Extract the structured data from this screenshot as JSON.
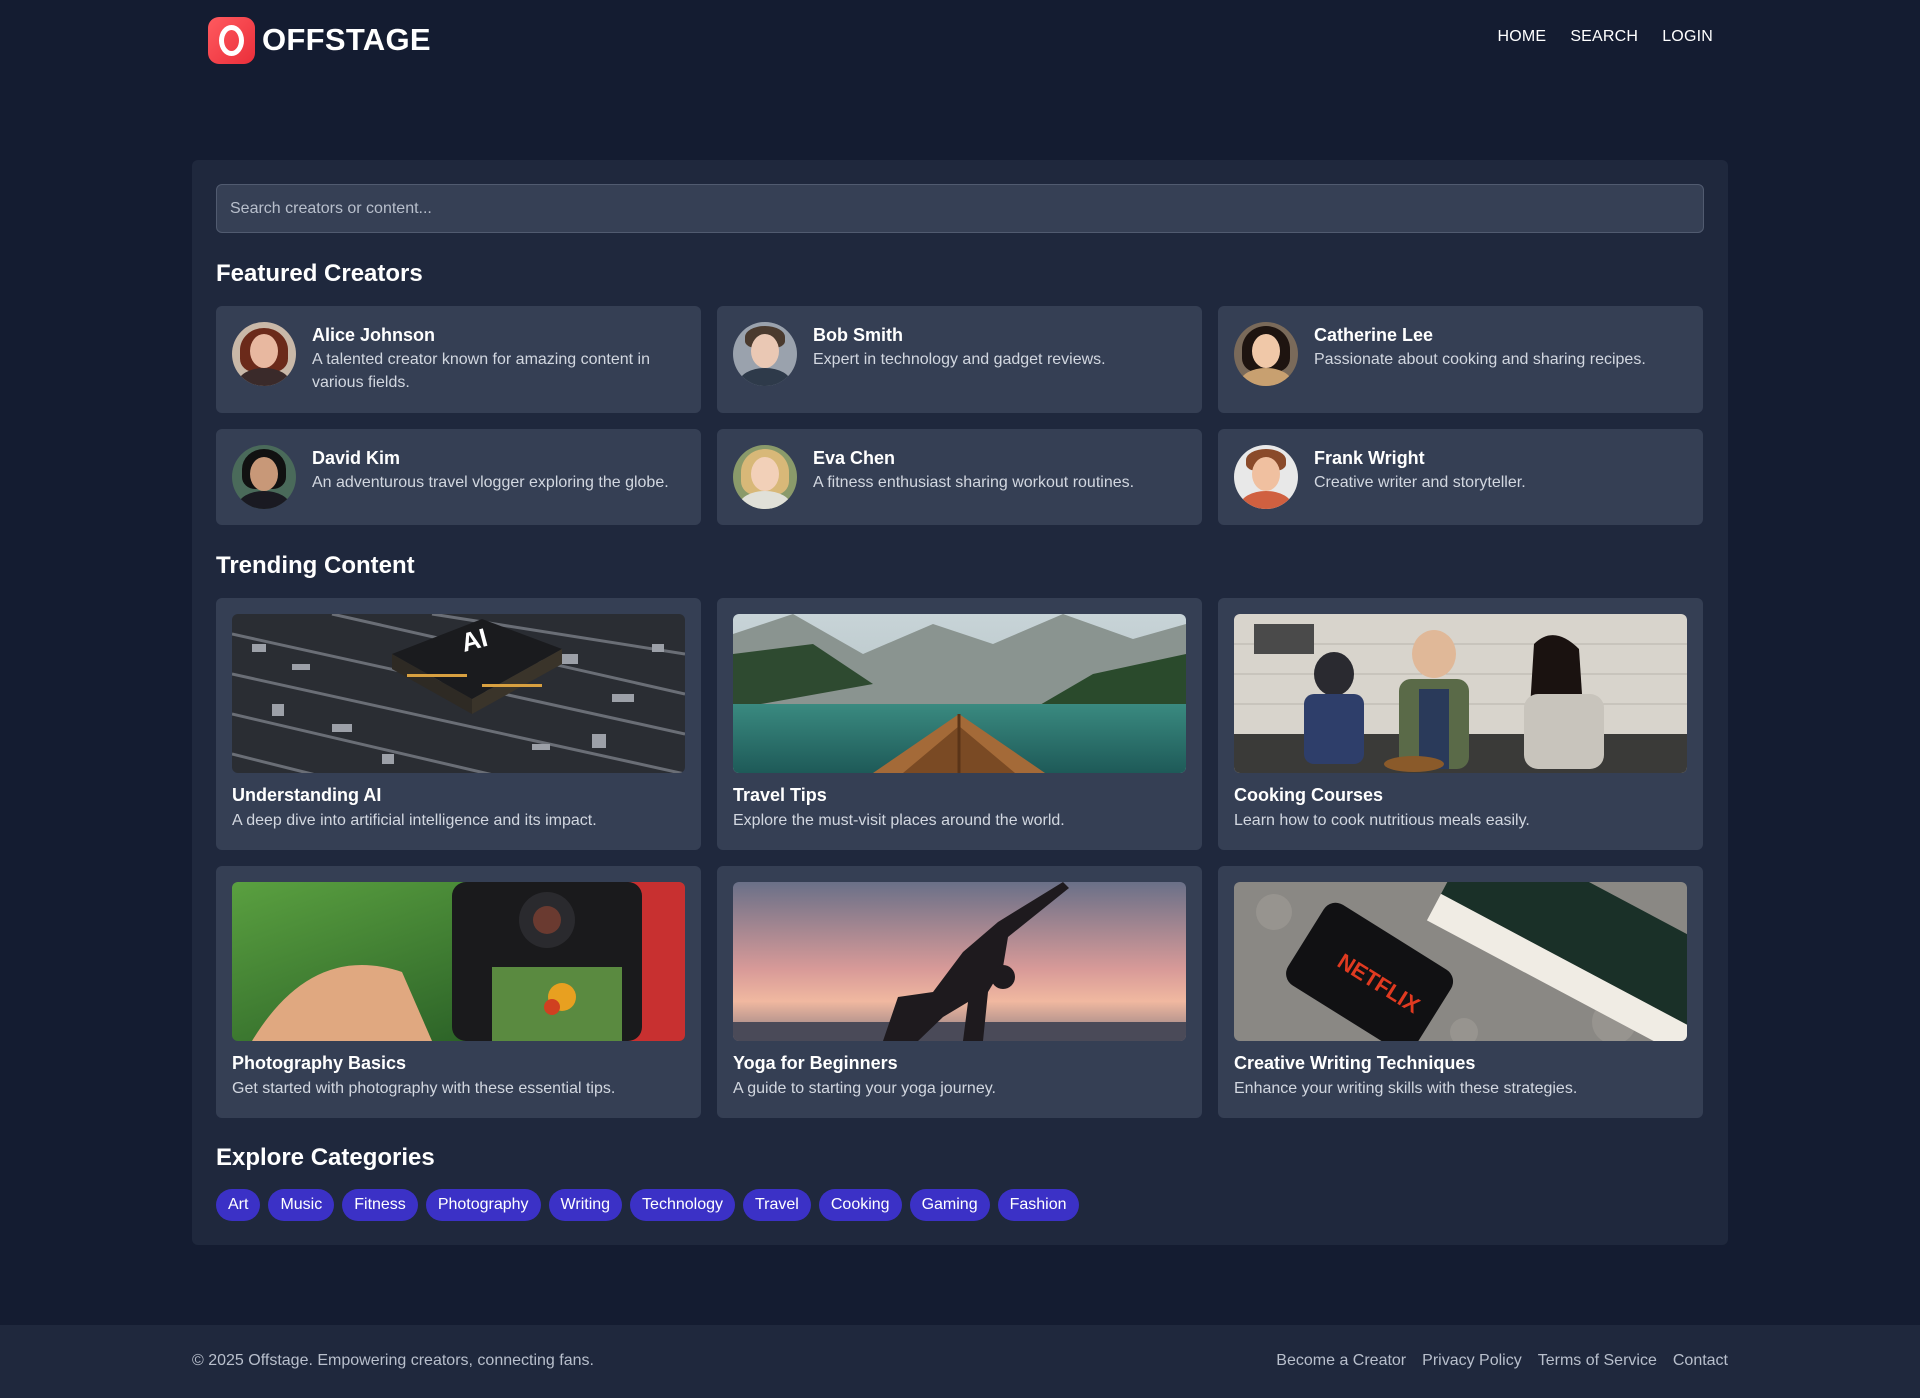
{
  "brand": {
    "name": "OFFSTAGE",
    "logo_letter": "O",
    "accent": "#f2363f"
  },
  "nav": [
    {
      "label": "HOME"
    },
    {
      "label": "SEARCH"
    },
    {
      "label": "LOGIN"
    }
  ],
  "search": {
    "placeholder": "Search creators or content..."
  },
  "featured": {
    "title": "Featured Creators",
    "creators": [
      {
        "name": "Alice Johnson",
        "bio": "A talented creator known for amazing content in various fields."
      },
      {
        "name": "Bob Smith",
        "bio": "Expert in technology and gadget reviews."
      },
      {
        "name": "Catherine Lee",
        "bio": "Passionate about cooking and sharing recipes."
      },
      {
        "name": "David Kim",
        "bio": "An adventurous travel vlogger exploring the globe."
      },
      {
        "name": "Eva Chen",
        "bio": "A fitness enthusiast sharing workout routines."
      },
      {
        "name": "Frank Wright",
        "bio": "Creative writer and storyteller."
      }
    ]
  },
  "trending": {
    "title": "Trending Content",
    "items": [
      {
        "title": "Understanding AI",
        "desc": "A deep dive into artificial intelligence and its impact."
      },
      {
        "title": "Travel Tips",
        "desc": "Explore the must-visit places around the world."
      },
      {
        "title": "Cooking Courses",
        "desc": "Learn how to cook nutritious meals easily."
      },
      {
        "title": "Photography Basics",
        "desc": "Get started with photography with these essential tips."
      },
      {
        "title": "Yoga for Beginners",
        "desc": "A guide to starting your yoga journey."
      },
      {
        "title": "Creative Writing Techniques",
        "desc": "Enhance your writing skills with these strategies."
      }
    ],
    "thumb_marks": {
      "chip": "AI",
      "phone_brand": "NETFLIX"
    }
  },
  "categories": {
    "title": "Explore Categories",
    "tags": [
      "Art",
      "Music",
      "Fitness",
      "Photography",
      "Writing",
      "Technology",
      "Travel",
      "Cooking",
      "Gaming",
      "Fashion"
    ]
  },
  "footer": {
    "copyright": "© 2025 Offstage. Empowering creators, connecting fans.",
    "links": [
      "Become a Creator",
      "Privacy Policy",
      "Terms of Service",
      "Contact"
    ]
  },
  "colors": {
    "background": "#141c31",
    "panel": "#1f283d",
    "card": "#353f54",
    "tag": "#3b31c6"
  }
}
